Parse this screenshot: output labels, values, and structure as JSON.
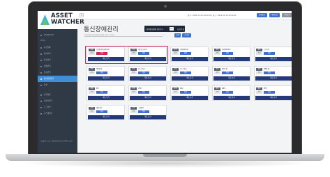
{
  "app": {
    "logo_line1": "ASSET",
    "logo_line2": "WATCHER"
  },
  "sidebar": {
    "items": [
      {
        "label": "Dashboard"
      },
      {
        "label": "자산현황"
      },
      {
        "label": "장비관리"
      },
      {
        "label": "회선관리"
      },
      {
        "label": "장애관리"
      },
      {
        "label": "점검관리"
      },
      {
        "label": "통신장애관리",
        "active": true
      },
      {
        "label": "통계"
      },
      {
        "label": "환경설정"
      },
      {
        "label": "사용자관리"
      },
      {
        "label": "로그관리"
      },
      {
        "label": "시스템관리"
      }
    ],
    "section_label": "MENU",
    "footer": "Logged in as : 관리자(admin) / 2022-11-16"
  },
  "topbar": {
    "menu_toggle": "≡",
    "info": "접속 : 2022-11-16 10:42:00 | 최근 : 2022-11-16 10:42:00",
    "buttons": [
      {
        "label": "회원정보",
        "color": "#3f6fd1"
      },
      {
        "label": "비밀번호",
        "color": "#3f6fd1"
      },
      {
        "label": "Logout",
        "color": "#8a93a0"
      }
    ]
  },
  "page": {
    "title": "통신장애관리",
    "legend_text": "장비통신장애 판단주기",
    "legend_value": "5분",
    "legend_suffix": "(초)/5 회 시도",
    "search_placeholder": "검색어를 입력하세요(장비명, 위치, 관리자)",
    "separator": "⌄",
    "search_button": "검색",
    "reset_button": "초기화"
  },
  "cards": [
    {
      "tag": "운영",
      "name": "보안장비(방화벽-01)",
      "label": "상태",
      "status": "장애",
      "status_color": "#d8245a",
      "button": "재도보기"
    },
    {
      "tag": "운영",
      "name": "네트워크(L3)",
      "label": "상태",
      "status": "정상",
      "status_color": "#3f6fd1",
      "button": "재도보기"
    },
    {
      "tag": "운영",
      "name": "서버(AP-01)",
      "label": "상태",
      "status": "정상",
      "status_color": "#3f6fd1",
      "button": "재도보기"
    },
    {
      "tag": "운영",
      "name": "서버(DB-01)",
      "label": "상태",
      "status": "정상",
      "status_color": "#3f6fd1",
      "button": "재도보기"
    },
    {
      "tag": "운영",
      "name": "스토리지",
      "label": "상태",
      "status": "정상",
      "status_color": "#3f6fd1",
      "button": "재도보기"
    },
    {
      "tag": "운영",
      "name": "백업장비",
      "label": "상태",
      "status": "정상",
      "status_color": "#3f6fd1",
      "button": "재도보기"
    },
    {
      "tag": "운영",
      "name": "L2 스위치",
      "label": "상태",
      "status": "정상",
      "status_color": "#3f6fd1",
      "button": "재도보기"
    },
    {
      "tag": "운영",
      "name": "L4 스위치",
      "label": "상태",
      "status": "정상",
      "status_color": "#3f6fd1",
      "button": "재도보기"
    },
    {
      "tag": "운영",
      "name": "WAS-01",
      "label": "상태",
      "status": "정상",
      "status_color": "#3f6fd1",
      "button": "재도보기"
    },
    {
      "tag": "운영",
      "name": "WEB-01",
      "label": "상태",
      "status": "정상",
      "status_color": "#3f6fd1",
      "button": "재도보기"
    },
    {
      "tag": "운영",
      "name": "IPS",
      "label": "상태",
      "status": "정상",
      "status_color": "#3f6fd1",
      "button": "재도보기"
    },
    {
      "tag": "운영",
      "name": "VPN",
      "label": "상태",
      "status": "정상",
      "status_color": "#3f6fd1",
      "button": "재도보기"
    },
    {
      "tag": "운영",
      "name": "NAC",
      "label": "상태",
      "status": "정상",
      "status_color": "#3f6fd1",
      "button": "재도보기"
    },
    {
      "tag": "운영",
      "name": "DNS",
      "label": "상태",
      "status": "정상",
      "status_color": "#3f6fd1",
      "button": "재도보기"
    },
    {
      "tag": "운영",
      "name": "NTP",
      "label": "상태",
      "status": "정상",
      "status_color": "#3f6fd1",
      "button": "재도보기"
    },
    {
      "tag": "운영",
      "name": "메일서버",
      "label": "상태",
      "status": "정상",
      "status_color": "#3f6fd1",
      "button": "재도보기"
    },
    {
      "tag": "운영",
      "name": "그룹웨어",
      "label": "상태",
      "status": "정상",
      "status_color": "#3f6fd1",
      "button": "재도보기"
    }
  ]
}
